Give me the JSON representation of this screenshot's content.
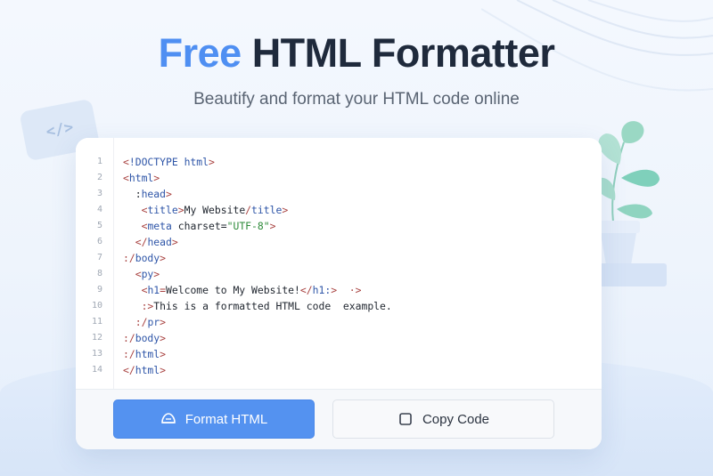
{
  "header": {
    "title_accent": "Free",
    "title_rest": "HTML Formatter",
    "subtitle": "Beautify and format your HTML code online"
  },
  "decor": {
    "code_badge": "</>",
    "colors": {
      "accent": "#4f8ff2",
      "button_primary": "#5492f0",
      "plant_leaf": "#7fd0bb"
    }
  },
  "editor": {
    "lines": [
      {
        "number": "1",
        "segments": [
          {
            "t": "<",
            "c": "br"
          },
          {
            "t": "!DOCTYPE html",
            "c": "tag"
          },
          {
            "t": ">",
            "c": "br"
          }
        ]
      },
      {
        "number": "2",
        "segments": [
          {
            "t": "<",
            "c": "br"
          },
          {
            "t": "html",
            "c": "tag"
          },
          {
            "t": ">",
            "c": "br"
          }
        ]
      },
      {
        "number": "3",
        "segments": [
          {
            "t": "  :",
            "c": "txt"
          },
          {
            "t": "head",
            "c": "tag"
          },
          {
            "t": ">",
            "c": "br"
          }
        ]
      },
      {
        "number": "4",
        "segments": [
          {
            "t": "   <",
            "c": "br"
          },
          {
            "t": "title",
            "c": "tag"
          },
          {
            "t": ">",
            "c": "br"
          },
          {
            "t": "My Website",
            "c": "txt"
          },
          {
            "t": "/",
            "c": "br"
          },
          {
            "t": "title",
            "c": "tag"
          },
          {
            "t": ">",
            "c": "br"
          }
        ]
      },
      {
        "number": "5",
        "segments": [
          {
            "t": "   <",
            "c": "br"
          },
          {
            "t": "meta",
            "c": "tag"
          },
          {
            "t": " charset=",
            "c": "txt"
          },
          {
            "t": "\"UTF-8\"",
            "c": "str"
          },
          {
            "t": ">",
            "c": "br"
          }
        ]
      },
      {
        "number": "6",
        "segments": [
          {
            "t": "  </",
            "c": "br"
          },
          {
            "t": "head",
            "c": "tag"
          },
          {
            "t": ">",
            "c": "br"
          }
        ]
      },
      {
        "number": "7",
        "segments": [
          {
            "t": ":/",
            "c": "br"
          },
          {
            "t": "body",
            "c": "tag"
          },
          {
            "t": ">",
            "c": "br"
          }
        ]
      },
      {
        "number": "8",
        "segments": [
          {
            "t": "  <",
            "c": "br"
          },
          {
            "t": "py",
            "c": "tag"
          },
          {
            "t": ">",
            "c": "br"
          }
        ]
      },
      {
        "number": "9",
        "segments": [
          {
            "t": "   <",
            "c": "br"
          },
          {
            "t": "h1",
            "c": "tag"
          },
          {
            "t": "=",
            "c": "br"
          },
          {
            "t": "Welcome to My Website!",
            "c": "txt"
          },
          {
            "t": "</",
            "c": "br"
          },
          {
            "t": "h1:",
            "c": "tag"
          },
          {
            "t": ">  ",
            "c": "br"
          },
          {
            "t": "·>",
            "c": "br"
          }
        ]
      },
      {
        "number": "10",
        "segments": [
          {
            "t": "   :>",
            "c": "br"
          },
          {
            "t": "This is a formatted HTML code  example.",
            "c": "txt"
          }
        ]
      },
      {
        "number": "11",
        "segments": [
          {
            "t": "  :/",
            "c": "br"
          },
          {
            "t": "pr",
            "c": "tag"
          },
          {
            "t": ">",
            "c": "br"
          }
        ]
      },
      {
        "number": "12",
        "segments": [
          {
            "t": ":/",
            "c": "br"
          },
          {
            "t": "body",
            "c": "tag"
          },
          {
            "t": ">",
            "c": "br"
          }
        ]
      },
      {
        "number": "13",
        "segments": [
          {
            "t": ":/",
            "c": "br"
          },
          {
            "t": "html",
            "c": "tag"
          },
          {
            "t": ">",
            "c": "br"
          }
        ]
      },
      {
        "number": "14",
        "segments": [
          {
            "t": "</",
            "c": "br"
          },
          {
            "t": "html",
            "c": "tag"
          },
          {
            "t": ">",
            "c": "br"
          }
        ]
      }
    ]
  },
  "actions": {
    "format": {
      "label": "Format HTML",
      "icon": "format-icon"
    },
    "copy": {
      "label": "Copy Code",
      "icon": "copy-icon"
    }
  }
}
